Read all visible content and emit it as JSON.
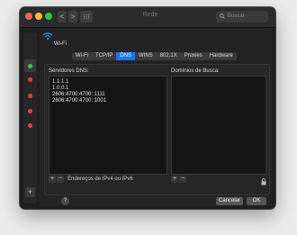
{
  "window": {
    "title": "Rede",
    "search_placeholder": "Buscar",
    "nav": {
      "back": "<",
      "forward": ">",
      "grid": "⁝⁝⁝"
    }
  },
  "interface": {
    "name": "Wi-Fi"
  },
  "tabs": [
    "Wi-Fi",
    "TCP/IP",
    "DNS",
    "WINS",
    "802.1X",
    "Proxies",
    "Hardware"
  ],
  "active_tab": "DNS",
  "dns": {
    "servers_label": "Servidores DNS:",
    "servers": [
      "1.1.1.1",
      "1.0.0.1",
      "2606:4700:4700::1111",
      "2606:4700:4700::1001"
    ],
    "add_label": "+",
    "remove_label": "−",
    "footer_note": "Endereços de IPv4 ou IPv6",
    "search_domains_label": "Domínios de Busca:",
    "search_domains": []
  },
  "buttons": {
    "help": "?",
    "cancel": "Cancelar",
    "ok": "OK",
    "sidebar_add": "+"
  },
  "colors": {
    "accent": "#1877f2",
    "status_green": "#2ecc40",
    "status_red": "#ff3b30"
  }
}
